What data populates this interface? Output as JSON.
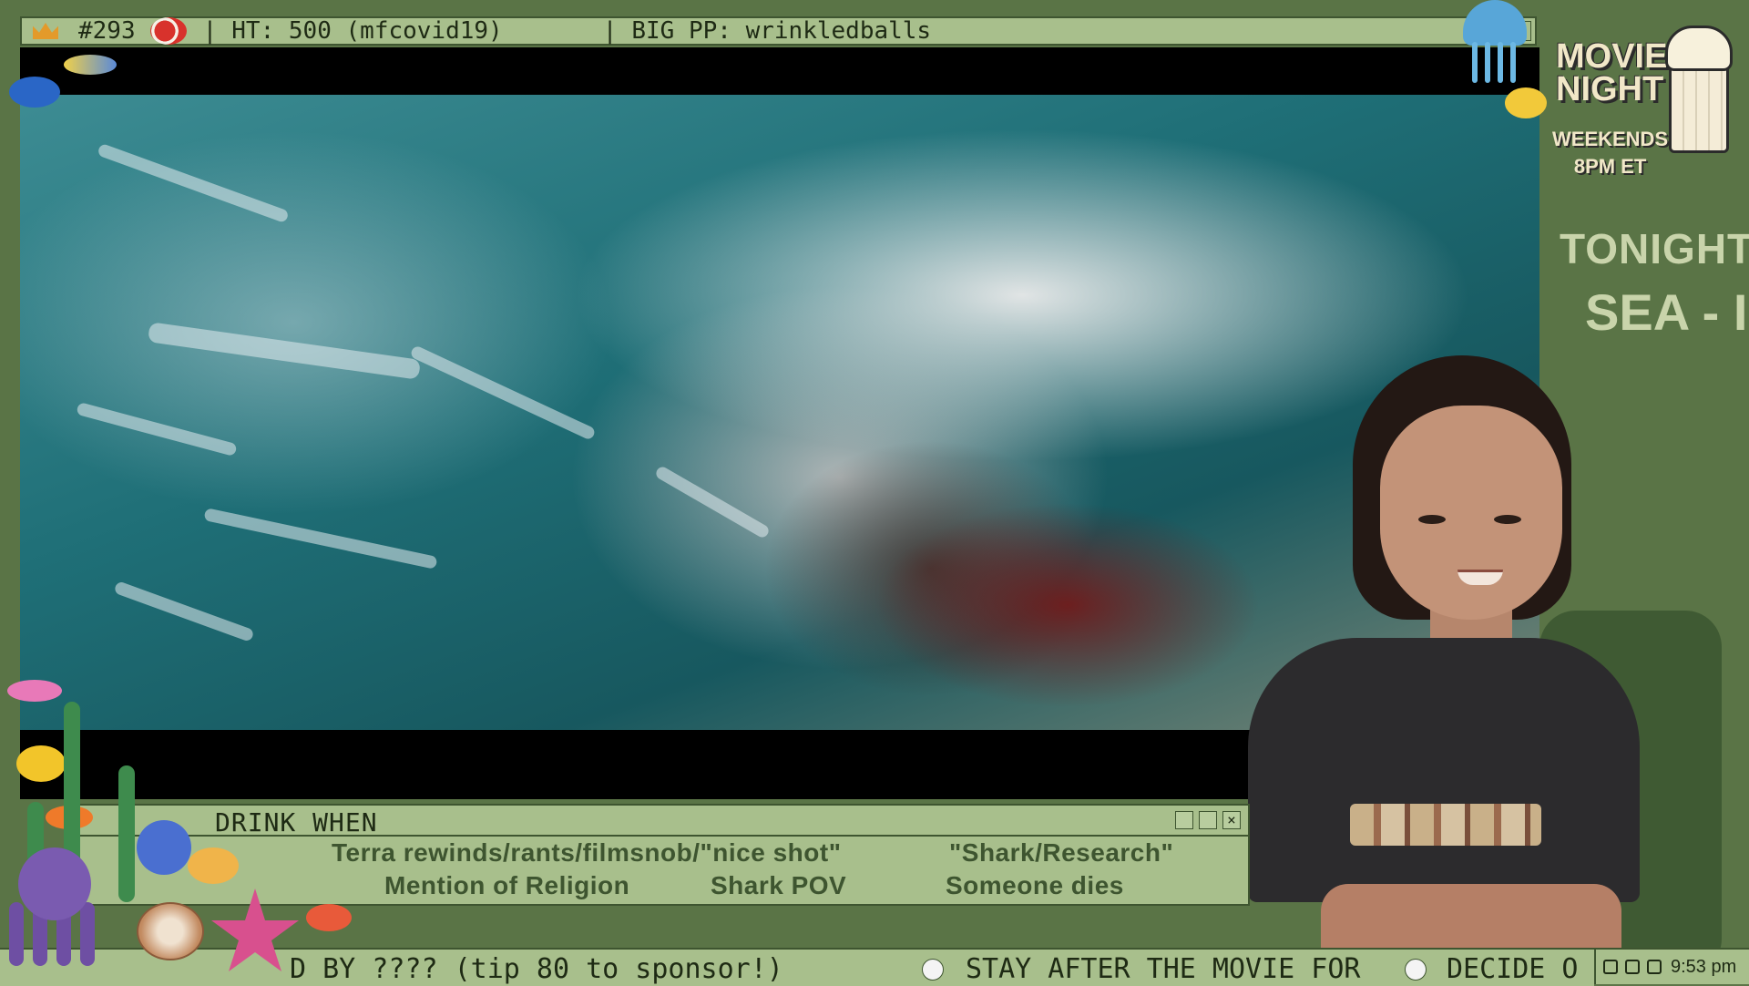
{
  "topbar": {
    "goal_number": "#293",
    "high_tip": "HT: 500 (mfcovid19)",
    "big_pp": "BIG PP: wrinkledballs",
    "close_label": "x"
  },
  "drink_panel": {
    "title": "DRINK WHEN",
    "rules": [
      "Terra rewinds/rants/filmsnob/\"nice shot\"",
      "\"Shark/Research\"",
      "Mention of Religion",
      "Shark POV",
      "Someone dies"
    ]
  },
  "ticker": {
    "segment_1": "D BY ???? (tip 80 to sponsor!)",
    "segment_2": "STAY AFTER THE MOVIE FOR",
    "segment_3": "DECIDE O"
  },
  "tray": {
    "time": "9:53 pm"
  },
  "movie_night": {
    "line1": "MOVIE",
    "line2": "NIGHT",
    "sub1": "WEEKENDS",
    "sub2": "8PM ET",
    "tonight_label": "TONIGHT:",
    "tonight_title": "SEA - I"
  },
  "colors": {
    "panel_bg": "#a8bf8c",
    "frame_green": "#5a7446",
    "border": "#3e5530"
  }
}
